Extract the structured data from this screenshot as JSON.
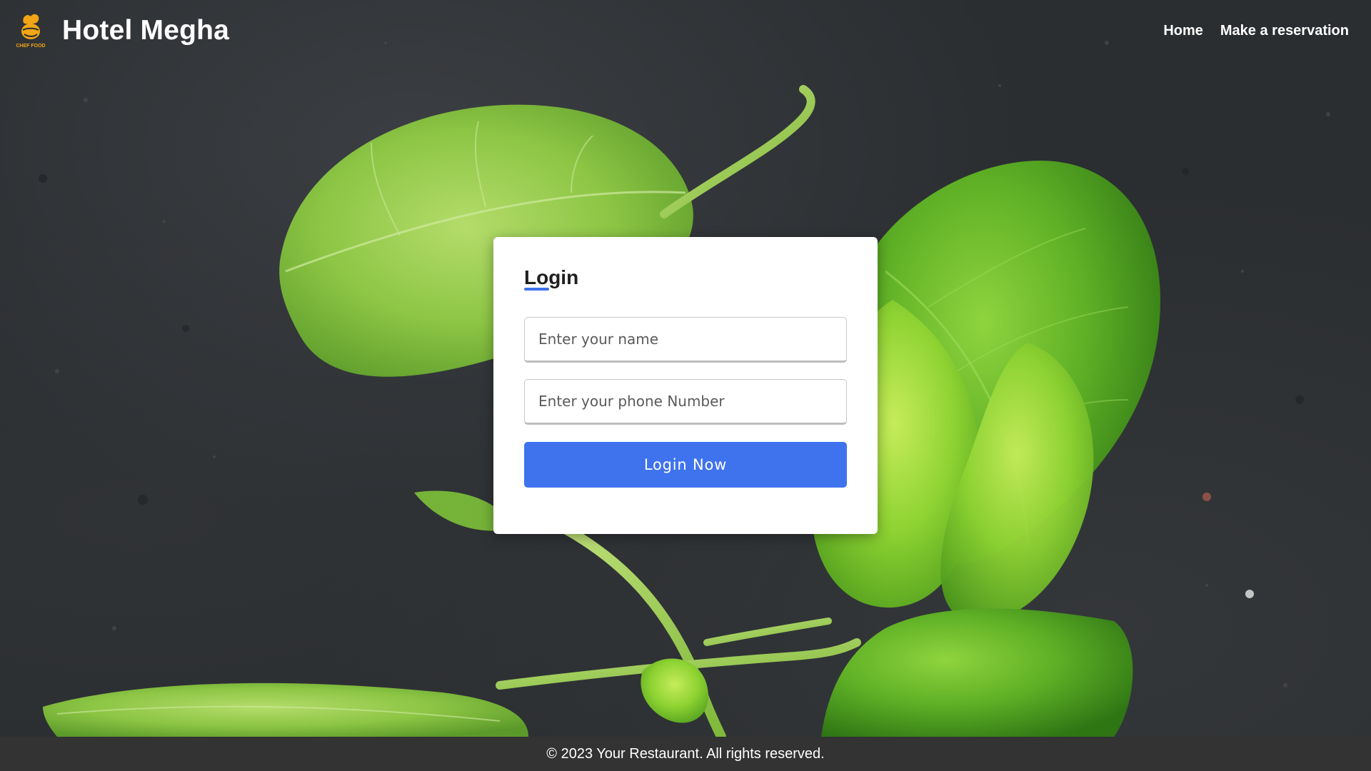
{
  "header": {
    "brand": "Hotel Megha",
    "logo_icon": "chef-food-logo-icon",
    "logo_text": "CHEF FOOD",
    "nav": [
      {
        "label": "Home"
      },
      {
        "label": "Make a reservation"
      }
    ]
  },
  "login": {
    "title": "Login",
    "name_placeholder": "Enter your name",
    "name_value": "",
    "phone_placeholder": "Enter your phone Number",
    "phone_value": "",
    "submit_label": "Login Now"
  },
  "footer": {
    "text": "© 2023 Your Restaurant. All rights reserved."
  },
  "colors": {
    "accent": "#3f73ee",
    "footer_bg": "#333333",
    "logo": "#f2a516",
    "leaf_light": "#9fd14a",
    "leaf_dark": "#3f8f1e"
  }
}
